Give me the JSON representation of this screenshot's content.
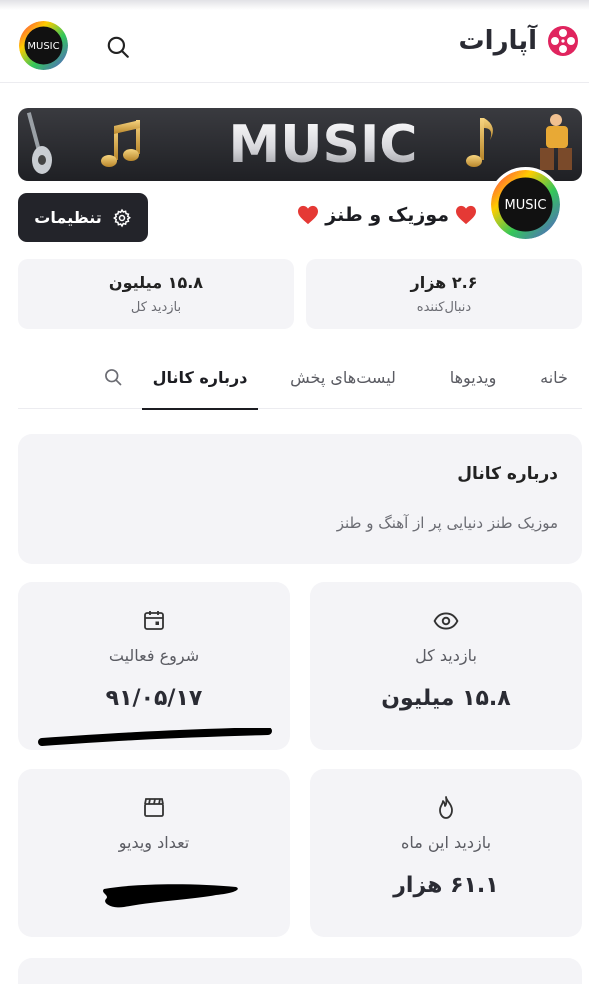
{
  "header": {
    "brand_name": "آپارات",
    "avatar_icon": "channel-avatar",
    "search_icon": "search-icon"
  },
  "banner": {
    "text": "MUSIC"
  },
  "avatar_text": "MUSIC",
  "channel": {
    "name": "موزیک و طنز",
    "settings_label": "تنظیمات"
  },
  "stats": {
    "followers_value": "۲.۶ هزار",
    "followers_label": "دنبال‌کننده",
    "views_value": "۱۵.۸ میلیون",
    "views_label": "بازدید کل"
  },
  "tabs": [
    {
      "label": "خانه"
    },
    {
      "label": "ویدیوها"
    },
    {
      "label": "لیست‌های پخش"
    },
    {
      "label": "درباره کانال"
    }
  ],
  "about": {
    "title": "درباره کانال",
    "description": "موزیک طنز دنیایی پر از آهنگ و طنز"
  },
  "info_cards": {
    "total_views": {
      "label": "بازدید کل",
      "value": "۱۵.۸ میلیون"
    },
    "start_date": {
      "label": "شروع فعالیت",
      "value": "۹۱/۰۵/۱۷"
    },
    "month_views": {
      "label": "بازدید این ماه",
      "value": "۶۱.۱ هزار"
    },
    "video_count": {
      "label": "تعداد ویدیو",
      "value": ""
    }
  },
  "colors": {
    "dark_button": "#23242a",
    "card_bg": "#f4f4f7",
    "brand_red": "#e0245e",
    "heart_red": "#e53935",
    "redaction": "#000000"
  }
}
